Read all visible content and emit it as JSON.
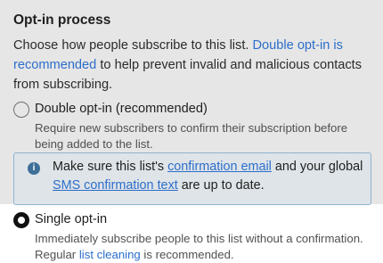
{
  "section": {
    "title": "Opt-in process"
  },
  "intro": {
    "text_before": "Choose how people subscribe to this list. ",
    "link": "Double opt-in is recommended",
    "text_after": " to help prevent invalid and malicious contacts from subscribing."
  },
  "options": [
    {
      "label": "Double opt-in (recommended)",
      "help": "Require new subscribers to confirm their subscription before being added to the list.",
      "checked": false
    },
    {
      "label": "Single opt-in",
      "help_before": "Immediately subscribe people to this list without a confirmation. Regular ",
      "help_link": "list cleaning",
      "help_after": " is recommended.",
      "checked": true
    }
  ],
  "banner": {
    "icon": "info-icon",
    "text_1": "Make sure this list's ",
    "link_1": "confirmation email",
    "text_2": " and your global ",
    "link_2": "SMS confirmation text",
    "text_3": " are up to date."
  },
  "colors": {
    "link": "#2c6ecb",
    "overlay": "#e6e6e6",
    "banner_bg": "#dfe4e8",
    "banner_border": "#8db3cf",
    "info_icon": "#3d6f99"
  }
}
